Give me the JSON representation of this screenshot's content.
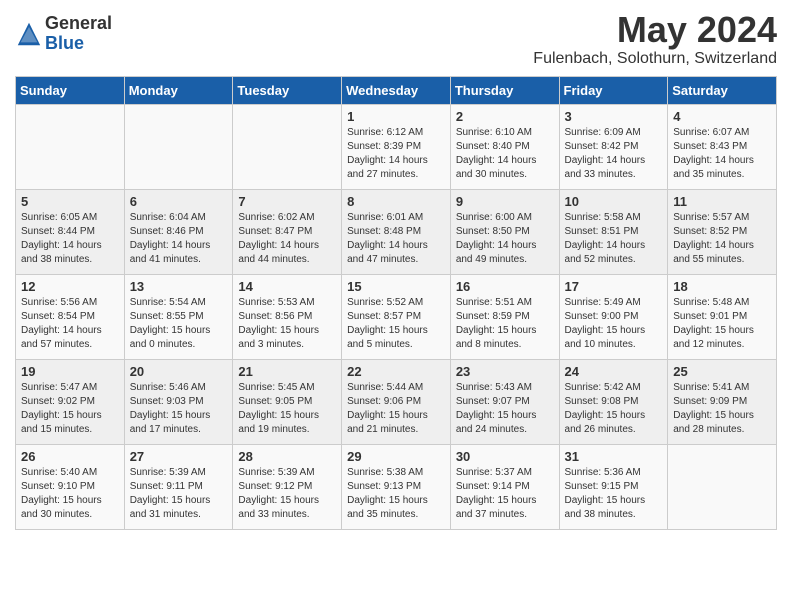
{
  "header": {
    "logo_general": "General",
    "logo_blue": "Blue",
    "month": "May 2024",
    "location": "Fulenbach, Solothurn, Switzerland"
  },
  "weekdays": [
    "Sunday",
    "Monday",
    "Tuesday",
    "Wednesday",
    "Thursday",
    "Friday",
    "Saturday"
  ],
  "weeks": [
    [
      {
        "day": "",
        "info": ""
      },
      {
        "day": "",
        "info": ""
      },
      {
        "day": "",
        "info": ""
      },
      {
        "day": "1",
        "info": "Sunrise: 6:12 AM\nSunset: 8:39 PM\nDaylight: 14 hours\nand 27 minutes."
      },
      {
        "day": "2",
        "info": "Sunrise: 6:10 AM\nSunset: 8:40 PM\nDaylight: 14 hours\nand 30 minutes."
      },
      {
        "day": "3",
        "info": "Sunrise: 6:09 AM\nSunset: 8:42 PM\nDaylight: 14 hours\nand 33 minutes."
      },
      {
        "day": "4",
        "info": "Sunrise: 6:07 AM\nSunset: 8:43 PM\nDaylight: 14 hours\nand 35 minutes."
      }
    ],
    [
      {
        "day": "5",
        "info": "Sunrise: 6:05 AM\nSunset: 8:44 PM\nDaylight: 14 hours\nand 38 minutes."
      },
      {
        "day": "6",
        "info": "Sunrise: 6:04 AM\nSunset: 8:46 PM\nDaylight: 14 hours\nand 41 minutes."
      },
      {
        "day": "7",
        "info": "Sunrise: 6:02 AM\nSunset: 8:47 PM\nDaylight: 14 hours\nand 44 minutes."
      },
      {
        "day": "8",
        "info": "Sunrise: 6:01 AM\nSunset: 8:48 PM\nDaylight: 14 hours\nand 47 minutes."
      },
      {
        "day": "9",
        "info": "Sunrise: 6:00 AM\nSunset: 8:50 PM\nDaylight: 14 hours\nand 49 minutes."
      },
      {
        "day": "10",
        "info": "Sunrise: 5:58 AM\nSunset: 8:51 PM\nDaylight: 14 hours\nand 52 minutes."
      },
      {
        "day": "11",
        "info": "Sunrise: 5:57 AM\nSunset: 8:52 PM\nDaylight: 14 hours\nand 55 minutes."
      }
    ],
    [
      {
        "day": "12",
        "info": "Sunrise: 5:56 AM\nSunset: 8:54 PM\nDaylight: 14 hours\nand 57 minutes."
      },
      {
        "day": "13",
        "info": "Sunrise: 5:54 AM\nSunset: 8:55 PM\nDaylight: 15 hours\nand 0 minutes."
      },
      {
        "day": "14",
        "info": "Sunrise: 5:53 AM\nSunset: 8:56 PM\nDaylight: 15 hours\nand 3 minutes."
      },
      {
        "day": "15",
        "info": "Sunrise: 5:52 AM\nSunset: 8:57 PM\nDaylight: 15 hours\nand 5 minutes."
      },
      {
        "day": "16",
        "info": "Sunrise: 5:51 AM\nSunset: 8:59 PM\nDaylight: 15 hours\nand 8 minutes."
      },
      {
        "day": "17",
        "info": "Sunrise: 5:49 AM\nSunset: 9:00 PM\nDaylight: 15 hours\nand 10 minutes."
      },
      {
        "day": "18",
        "info": "Sunrise: 5:48 AM\nSunset: 9:01 PM\nDaylight: 15 hours\nand 12 minutes."
      }
    ],
    [
      {
        "day": "19",
        "info": "Sunrise: 5:47 AM\nSunset: 9:02 PM\nDaylight: 15 hours\nand 15 minutes."
      },
      {
        "day": "20",
        "info": "Sunrise: 5:46 AM\nSunset: 9:03 PM\nDaylight: 15 hours\nand 17 minutes."
      },
      {
        "day": "21",
        "info": "Sunrise: 5:45 AM\nSunset: 9:05 PM\nDaylight: 15 hours\nand 19 minutes."
      },
      {
        "day": "22",
        "info": "Sunrise: 5:44 AM\nSunset: 9:06 PM\nDaylight: 15 hours\nand 21 minutes."
      },
      {
        "day": "23",
        "info": "Sunrise: 5:43 AM\nSunset: 9:07 PM\nDaylight: 15 hours\nand 24 minutes."
      },
      {
        "day": "24",
        "info": "Sunrise: 5:42 AM\nSunset: 9:08 PM\nDaylight: 15 hours\nand 26 minutes."
      },
      {
        "day": "25",
        "info": "Sunrise: 5:41 AM\nSunset: 9:09 PM\nDaylight: 15 hours\nand 28 minutes."
      }
    ],
    [
      {
        "day": "26",
        "info": "Sunrise: 5:40 AM\nSunset: 9:10 PM\nDaylight: 15 hours\nand 30 minutes."
      },
      {
        "day": "27",
        "info": "Sunrise: 5:39 AM\nSunset: 9:11 PM\nDaylight: 15 hours\nand 31 minutes."
      },
      {
        "day": "28",
        "info": "Sunrise: 5:39 AM\nSunset: 9:12 PM\nDaylight: 15 hours\nand 33 minutes."
      },
      {
        "day": "29",
        "info": "Sunrise: 5:38 AM\nSunset: 9:13 PM\nDaylight: 15 hours\nand 35 minutes."
      },
      {
        "day": "30",
        "info": "Sunrise: 5:37 AM\nSunset: 9:14 PM\nDaylight: 15 hours\nand 37 minutes."
      },
      {
        "day": "31",
        "info": "Sunrise: 5:36 AM\nSunset: 9:15 PM\nDaylight: 15 hours\nand 38 minutes."
      },
      {
        "day": "",
        "info": ""
      }
    ]
  ]
}
